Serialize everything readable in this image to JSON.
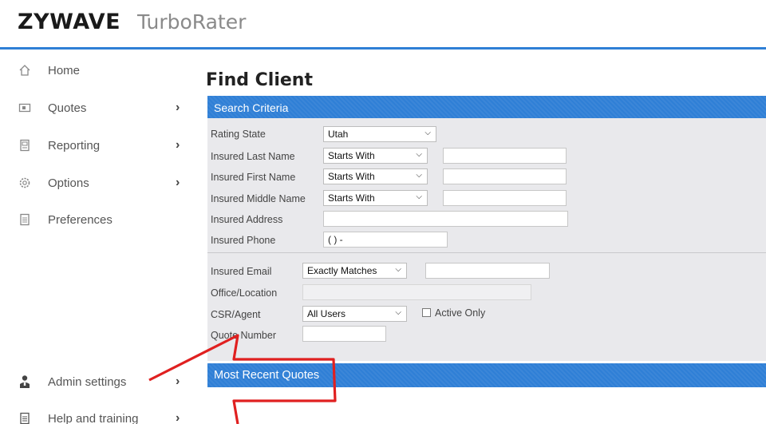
{
  "header": {
    "brand": "ZYWAVE",
    "product": "TurboRater"
  },
  "sidebar": {
    "items": [
      {
        "label": "Home",
        "icon": "home-icon"
      },
      {
        "label": "Quotes",
        "icon": "quotes-icon",
        "chevron": "›"
      },
      {
        "label": "Reporting",
        "icon": "reporting-icon",
        "chevron": "›"
      },
      {
        "label": "Options",
        "icon": "gear-icon",
        "chevron": "›"
      },
      {
        "label": "Preferences",
        "icon": "document-icon"
      },
      {
        "label": "Admin settings",
        "icon": "user-icon",
        "chevron": "›"
      },
      {
        "label": "Help and training",
        "icon": "help-document-icon",
        "chevron": "›"
      }
    ]
  },
  "main": {
    "title": "Find Client",
    "search_criteria": {
      "header": "Search Criteria",
      "fields": {
        "rating_state": {
          "label": "Rating State",
          "value": "Utah"
        },
        "last_name": {
          "label": "Insured Last Name",
          "match": "Starts With",
          "value": ""
        },
        "first_name": {
          "label": "Insured First Name",
          "match": "Starts With",
          "value": ""
        },
        "middle_name": {
          "label": "Insured Middle Name",
          "match": "Starts With",
          "value": ""
        },
        "address": {
          "label": "Insured Address",
          "value": ""
        },
        "phone": {
          "label": "Insured Phone",
          "value": "(  )   -"
        },
        "email": {
          "label": "Insured Email",
          "match": "Exactly Matches",
          "value": ""
        },
        "office": {
          "label": "Office/Location",
          "value": ""
        },
        "csr_agent": {
          "label": "CSR/Agent",
          "value": "All Users",
          "active_only_label": "Active Only"
        },
        "quote_number": {
          "label": "Quote Number",
          "value": ""
        }
      }
    },
    "recent_quotes": {
      "header": "Most Recent Quotes"
    }
  },
  "annotation": {
    "arrow_color": "#e02020"
  }
}
